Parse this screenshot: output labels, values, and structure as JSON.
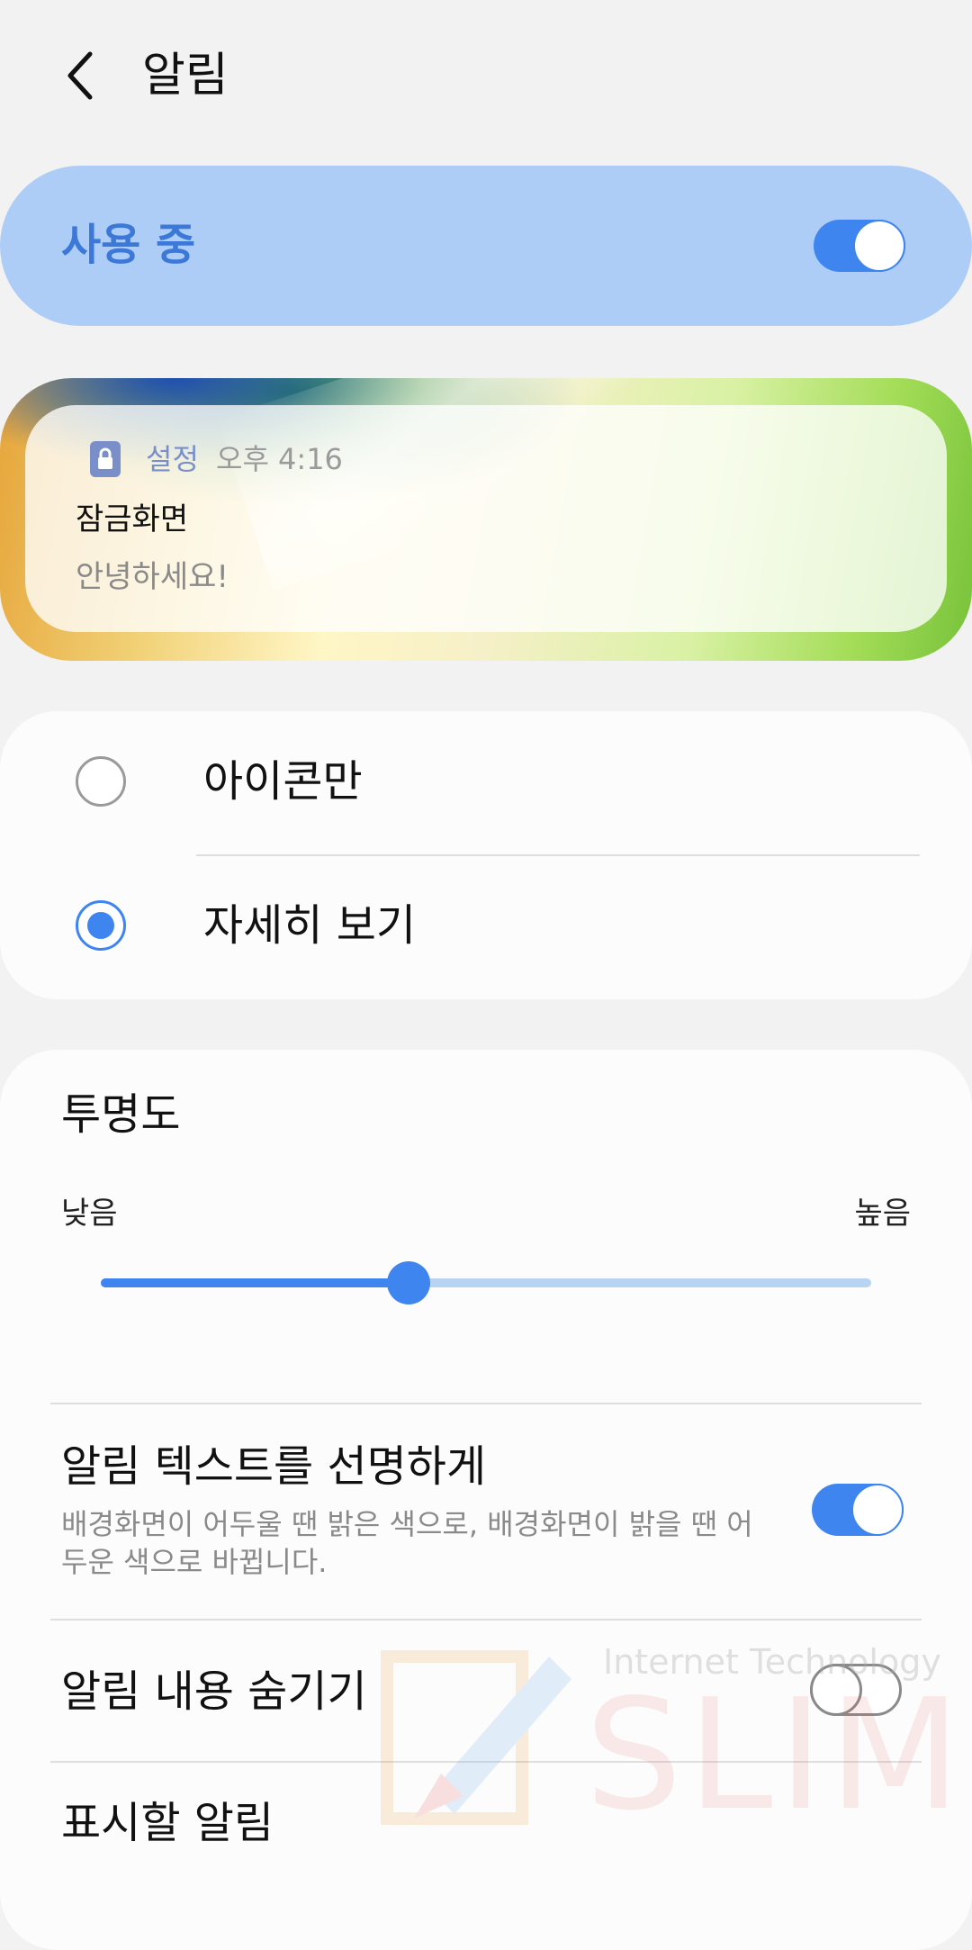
{
  "header": {
    "title": "알림",
    "back_icon": "chevron-left-icon"
  },
  "master": {
    "label": "사용 중",
    "enabled": true
  },
  "preview": {
    "app_name": "설정",
    "time": "오후 4:16",
    "title": "잠금화면",
    "body": "안녕하세요!",
    "app_icon": "lock-icon"
  },
  "style_options": {
    "items": [
      {
        "label": "아이콘만",
        "selected": false
      },
      {
        "label": "자세히 보기",
        "selected": true
      }
    ]
  },
  "transparency": {
    "title": "투명도",
    "low_label": "낮음",
    "high_label": "높음",
    "level": 0.4
  },
  "settings": {
    "clear_text": {
      "title": "알림 텍스트를 선명하게",
      "description": "배경화면이 어두울 땐 밝은 색으로, 배경화면이 밝을 땐 어두운 색으로 바뀝니다.",
      "enabled": true
    },
    "hide_content": {
      "title": "알림 내용 숨기기",
      "enabled": false
    },
    "show_notifications": {
      "title": "표시할 알림"
    }
  },
  "watermark": {
    "line1": "Internet Technology",
    "line2": "SLIM"
  },
  "colors": {
    "accent": "#3e85f0",
    "master_bg": "#aecdf6",
    "master_text": "#3c78d8",
    "page_bg": "#f2f2f2"
  }
}
